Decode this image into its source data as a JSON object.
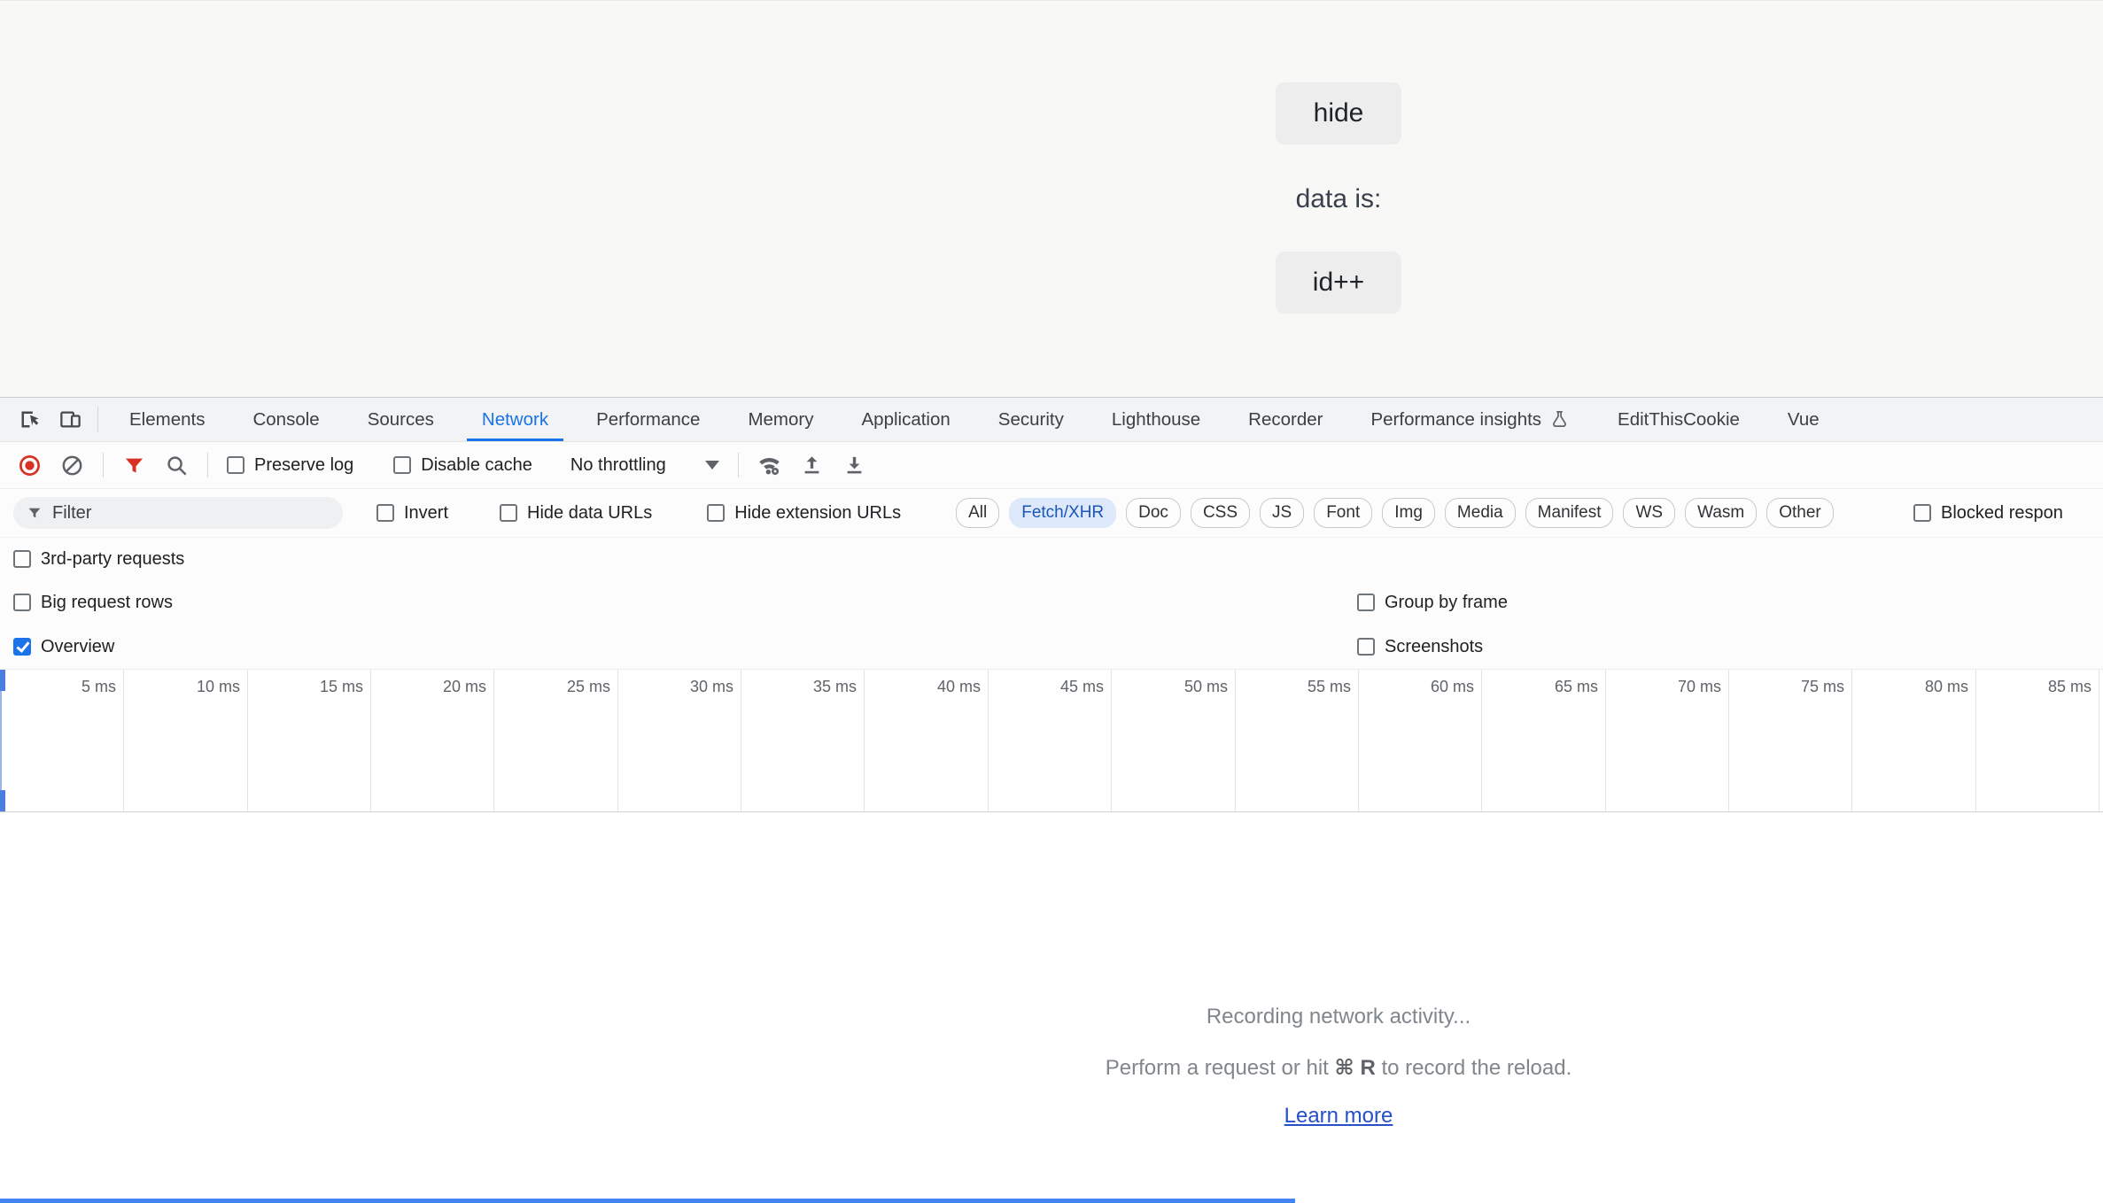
{
  "page": {
    "hide_button": "hide",
    "data_label": "data is:",
    "increment_button": "id++"
  },
  "devtools": {
    "tabs": [
      "Elements",
      "Console",
      "Sources",
      "Network",
      "Performance",
      "Memory",
      "Application",
      "Security",
      "Lighthouse",
      "Recorder",
      "Performance insights",
      "EditThisCookie",
      "Vue"
    ],
    "selected_tab": "Network",
    "toolbar": {
      "preserve_log": "Preserve log",
      "disable_cache": "Disable cache",
      "throttling": "No throttling"
    },
    "filter_bar": {
      "placeholder": "Filter",
      "invert": "Invert",
      "hide_data_urls": "Hide data URLs",
      "hide_extension_urls": "Hide extension URLs",
      "resource_pills": [
        "All",
        "Fetch/XHR",
        "Doc",
        "CSS",
        "JS",
        "Font",
        "Img",
        "Media",
        "Manifest",
        "WS",
        "Wasm",
        "Other"
      ],
      "selected_pill": "Fetch/XHR",
      "blocked_response": "Blocked respon"
    },
    "options": {
      "third_party_requests": "3rd-party requests",
      "big_request_rows": "Big request rows",
      "group_by_frame": "Group by frame",
      "overview": "Overview",
      "screenshots": "Screenshots"
    },
    "overview_checked": true,
    "timeline_ticks": [
      "5 ms",
      "10 ms",
      "15 ms",
      "20 ms",
      "25 ms",
      "30 ms",
      "35 ms",
      "40 ms",
      "45 ms",
      "50 ms",
      "55 ms",
      "60 ms",
      "65 ms",
      "70 ms",
      "75 ms",
      "80 ms",
      "85 ms"
    ],
    "empty_state": {
      "line1": "Recording network activity...",
      "line2_prefix": "Perform a request or hit ",
      "shortcut": "⌘ R",
      "line2_suffix": " to record the reload.",
      "learn_more": "Learn more"
    }
  },
  "icons": {
    "inspect-element-icon": "cursor-in-box",
    "device-toolbar-icon": "stacked-devices",
    "record-icon": "red-record-circle",
    "clear-icon": "circle-slash",
    "filter-toggle-icon": "red-funnel",
    "search-icon": "magnifier",
    "network-conditions-icon": "wifi-gear",
    "import-har-icon": "arrow-up-tray",
    "export-har-icon": "arrow-down-tray",
    "experiment-icon": "flask",
    "dropdown-caret-icon": "triangle-down",
    "filter-input-icon": "funnel"
  },
  "colors": {
    "accent": "#1a73e8",
    "record_red": "#d93025",
    "selection_blue": "#4285f4",
    "link_blue": "#2450c8"
  }
}
